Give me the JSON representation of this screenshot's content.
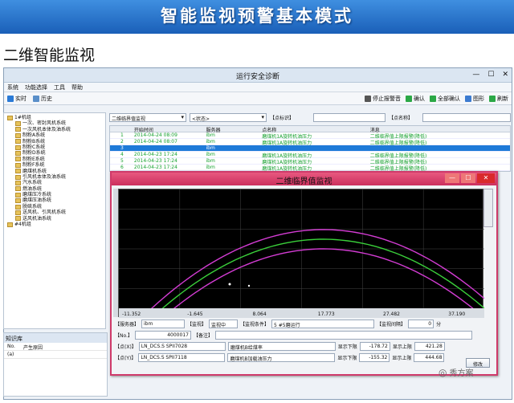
{
  "banner": {
    "title": "智能监视预警基本模式"
  },
  "page": {
    "title": "二维智能监视"
  },
  "window": {
    "title": "运行安全诊断",
    "controls": [
      "—",
      "☐",
      "✕"
    ]
  },
  "menu": [
    "系统",
    "功能选择",
    "工具",
    "帮助"
  ],
  "toolbar": {
    "left": [
      {
        "label": "实时"
      },
      {
        "label": "历史"
      }
    ],
    "right": [
      {
        "label": "停止报警音"
      },
      {
        "label": "确认"
      },
      {
        "label": "全部确认"
      },
      {
        "label": "图形"
      },
      {
        "label": "刷新"
      }
    ]
  },
  "tree": [
    {
      "label": "1#机组",
      "indent": 0
    },
    {
      "label": "一次、密封风机系统",
      "indent": 2
    },
    {
      "label": "一次风机本体及油系统",
      "indent": 2
    },
    {
      "label": "制粉A系统",
      "indent": 2
    },
    {
      "label": "制粉B系统",
      "indent": 2
    },
    {
      "label": "制粉C系统",
      "indent": 2
    },
    {
      "label": "制粉D系统",
      "indent": 2
    },
    {
      "label": "制粉E系统",
      "indent": 2
    },
    {
      "label": "制粉F系统",
      "indent": 2
    },
    {
      "label": "磨煤机系统",
      "indent": 2
    },
    {
      "label": "引风机本体及油系统",
      "indent": 2
    },
    {
      "label": "汽水系统",
      "indent": 2
    },
    {
      "label": "燃油系统",
      "indent": 2
    },
    {
      "label": "磨煤压冷系统",
      "indent": 2
    },
    {
      "label": "磨煤压油系统",
      "indent": 2
    },
    {
      "label": "脱硫系统",
      "indent": 2
    },
    {
      "label": "送风机、引风机系统",
      "indent": 2
    },
    {
      "label": "送风机油系统",
      "indent": 2
    },
    {
      "label": "#4机组",
      "indent": 0
    }
  ],
  "filter": {
    "combo1": "二维临界值监视",
    "combo2": "<状态>",
    "point_label": "【点标识】",
    "name_label": "【点名称】"
  },
  "table": {
    "headers": [
      "",
      "开始时间",
      "服务器",
      "点名称",
      "消息"
    ],
    "rows": [
      {
        "n": "1",
        "time": "2014-04-24 08:09",
        "server": "ibm",
        "name": "磨煤机1A旋转机油压力",
        "msg": "二维临界值上限报警(降低)"
      },
      {
        "n": "2",
        "time": "2014-04-24 08:07",
        "server": "ibm",
        "name": "磨煤机1A旋转机油压力",
        "msg": "二维临界值上限报警(降低)"
      },
      {
        "n": "3",
        "time": "",
        "server": "ibm",
        "name": "",
        "msg": ""
      },
      {
        "n": "4",
        "time": "2014-04-23 17:24",
        "server": "ibm",
        "name": "磨煤机1A旋转机油压力",
        "msg": "二维临界值上限报警(降低)"
      },
      {
        "n": "5",
        "time": "2014-04-23 17:24",
        "server": "ibm",
        "name": "磨煤机1A旋转机油压力",
        "msg": "二维临界值上限报警(降低)"
      },
      {
        "n": "6",
        "time": "2014-04-23 17:24",
        "server": "ibm",
        "name": "磨煤机1A旋转机油压力",
        "msg": "二维临界值上限报警(降低)"
      }
    ]
  },
  "bottom": {
    "title": "知识库",
    "col1": "No.",
    "col2": "产生原因",
    "row1": "(a)"
  },
  "dialog": {
    "title": "二维临界值监视",
    "x_ticks": [
      "-11.352",
      "-1.645",
      "8.064",
      "17.773",
      "27.482",
      "37.190"
    ],
    "server_label": "【服务器】",
    "server_value": "ibm",
    "monitor_label": "【监视】",
    "monitor_value": "监视中",
    "cond_label": "【监视条件】",
    "cond_value": "5 #5磨运行",
    "interval_label": "【监视间隔】",
    "interval_value": "0",
    "interval_unit": "分",
    "no_label": "【No.】",
    "no_value": "4000017",
    "note_label": "【备注】",
    "x_label": "【点(X)】",
    "x_code": "LN_DCS.S SPII7028",
    "x_name": "磨煤机B给煤率",
    "y_label": "【点(Y)】",
    "y_code": "LN_DCS.S SPII7118",
    "y_name": "磨煤机B加载油压力",
    "lower_label": "显示下限",
    "upper_label": "显示上限",
    "x_lower": "-178.72",
    "x_upper": "421.28",
    "y_lower": "-155.32",
    "y_upper": "444.68",
    "modify_label": "修改"
  },
  "watermark": "秀方案"
}
